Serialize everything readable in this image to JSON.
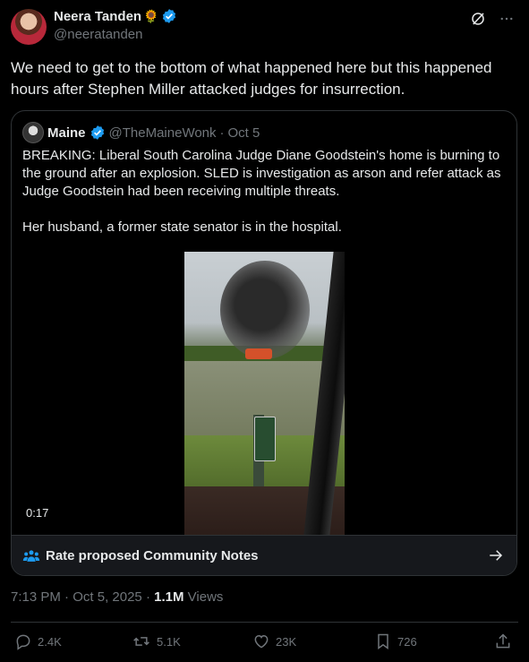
{
  "author": {
    "name": "Neera Tanden",
    "emoji": "🌻",
    "handle": "@neeratanden"
  },
  "tweet": {
    "text": "We need to get to the bottom of what happened here but this happened hours after Stephen Miller attacked judges for insurrection."
  },
  "quoted": {
    "name": "Maine",
    "handle": "@TheMaineWonk",
    "separator": "·",
    "date": "Oct 5",
    "paragraph1": "BREAKING:  Liberal South Carolina Judge Diane Goodstein's home is burning to the ground after an explosion. SLED is investigation as arson and refer attack as Judge Goodstein had been receiving multiple threats.",
    "paragraph2": "Her husband, a former state senator is in the hospital.",
    "video_duration": "0:17"
  },
  "community_notes": {
    "label": "Rate proposed Community Notes"
  },
  "meta": {
    "time": "7:13 PM",
    "date": "Oct 5, 2025",
    "views_count": "1.1M",
    "views_label": "Views",
    "dot": "·"
  },
  "actions": {
    "replies": "2.4K",
    "reposts": "5.1K",
    "likes": "23K",
    "bookmarks": "726"
  },
  "icons": [
    "grok-icon",
    "more-icon",
    "verified-icon",
    "people-icon",
    "arrow-right-icon",
    "reply-icon",
    "repost-icon",
    "like-icon",
    "bookmark-icon",
    "share-icon"
  ],
  "colors": {
    "background": "#000000",
    "text": "#e7e9ea",
    "muted": "#71767b",
    "verified": "#1d9bf0",
    "border": "#2f3336"
  }
}
